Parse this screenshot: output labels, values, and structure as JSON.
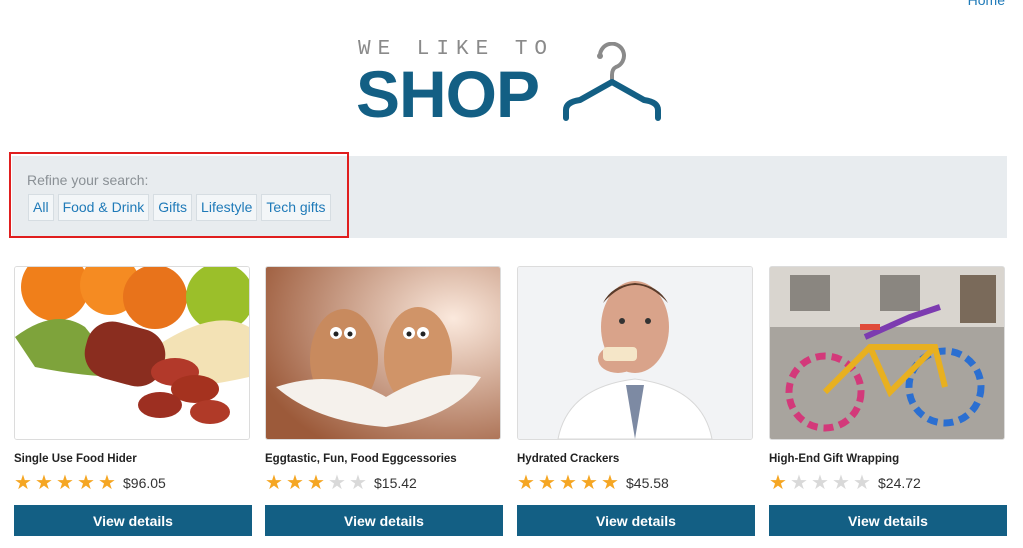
{
  "header": {
    "home_link": "Home"
  },
  "logo": {
    "tagline": "WE LIKE TO",
    "word": "SHOP",
    "icon": "hanger-icon"
  },
  "filters": {
    "label": "Refine your search:",
    "options": [
      "All",
      "Food & Drink",
      "Gifts",
      "Lifestyle",
      "Tech gifts"
    ]
  },
  "colors": {
    "brand": "#135f84",
    "link": "#1f7ab8",
    "star": "#f5a623",
    "highlight": "#e01e1e"
  },
  "products": [
    {
      "name": "Single Use Food Hider",
      "rating": 5,
      "price": "$96.05",
      "button": "View details"
    },
    {
      "name": "Eggtastic, Fun, Food Eggcessories",
      "rating": 3,
      "price": "$15.42",
      "button": "View details"
    },
    {
      "name": "Hydrated Crackers",
      "rating": 5,
      "price": "$45.58",
      "button": "View details"
    },
    {
      "name": "High-End Gift Wrapping",
      "rating": 1,
      "price": "$24.72",
      "button": "View details"
    }
  ]
}
